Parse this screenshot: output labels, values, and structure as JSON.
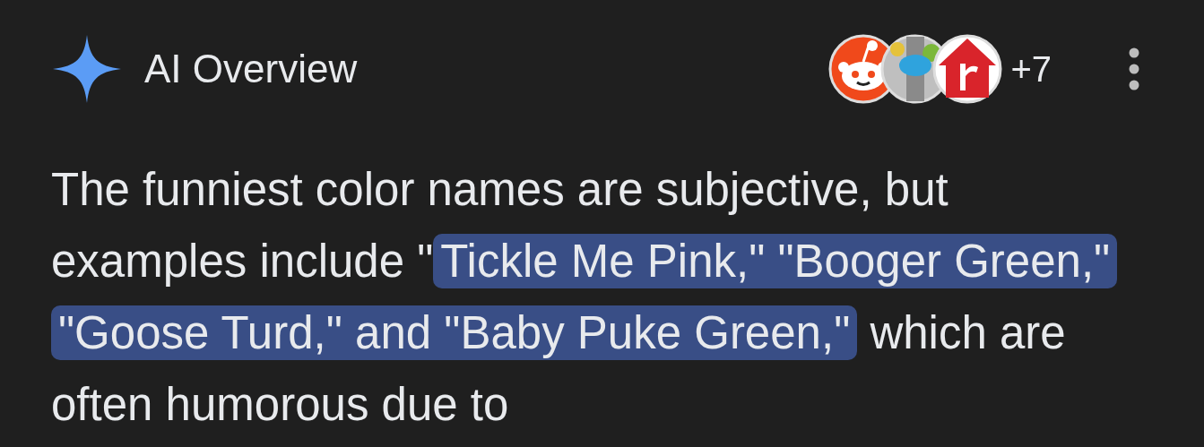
{
  "header": {
    "title": "AI Overview",
    "sources": [
      {
        "kind": "mascot"
      },
      {
        "kind": "disc"
      },
      {
        "kind": "house"
      }
    ],
    "more_sources": "+7"
  },
  "paragraph": {
    "segments": [
      {
        "text": "The funniest color names are subjective, but examples include \"",
        "highlighted": false
      },
      {
        "text": "Tickle Me Pink,\" \"Booger Green,\" \"Goose Turd,\" and \"Baby Puke Green,\"",
        "highlighted": true
      },
      {
        "text": " which are often humorous due to",
        "highlighted": false
      }
    ]
  }
}
